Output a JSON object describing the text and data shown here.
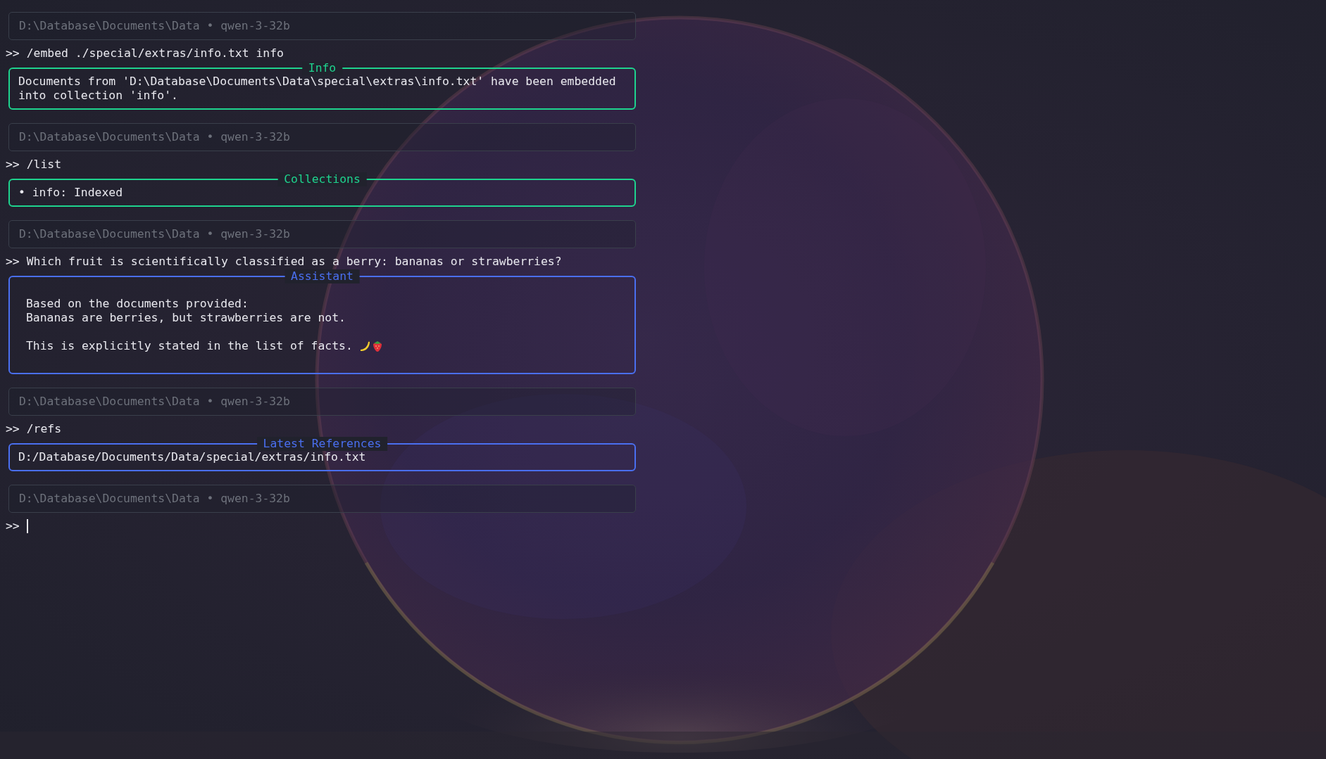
{
  "blocks": [
    {
      "kind": "status",
      "path": "D:\\Database\\Documents\\Data",
      "separator": "•",
      "model": "qwen-3-32b"
    },
    {
      "kind": "prompt",
      "marker": ">>",
      "text": "/embed ./special/extras/info.txt info"
    },
    {
      "kind": "panel",
      "title": "Info",
      "color": "#1ed38e",
      "padded": false,
      "lines": [
        {
          "text": "Documents from 'D:\\Database\\Documents\\Data\\special\\extras\\info.txt' have been embedded"
        },
        {
          "text": "into collection 'info'."
        }
      ]
    },
    {
      "kind": "status",
      "path": "D:\\Database\\Documents\\Data",
      "separator": "•",
      "model": "qwen-3-32b"
    },
    {
      "kind": "prompt",
      "marker": ">>",
      "text": "/list"
    },
    {
      "kind": "panel",
      "title": "Collections",
      "color": "#1ed38e",
      "padded": false,
      "lines": [
        {
          "text": "• info: Indexed"
        }
      ]
    },
    {
      "kind": "status",
      "path": "D:\\Database\\Documents\\Data",
      "separator": "•",
      "model": "qwen-3-32b"
    },
    {
      "kind": "prompt",
      "marker": ">>",
      "text": "Which fruit is scientifically classified as a berry: bananas or strawberries?"
    },
    {
      "kind": "panel",
      "title": "Assistant",
      "color": "#4a6ff0",
      "padded": true,
      "lines": [
        {
          "text": "Based on the documents provided:"
        },
        {
          "text": "Bananas are berries, but strawberries are not."
        },
        {
          "text": "This is explicitly stated in the list of facts.",
          "emoji": true,
          "gap_before": true
        }
      ]
    },
    {
      "kind": "status",
      "path": "D:\\Database\\Documents\\Data",
      "separator": "•",
      "model": "qwen-3-32b"
    },
    {
      "kind": "prompt",
      "marker": ">>",
      "text": "/refs"
    },
    {
      "kind": "panel",
      "title": "Latest References",
      "color": "#4a6ff0",
      "padded": false,
      "lines": [
        {
          "text": "D:/Database/Documents/Data/special/extras/info.txt"
        }
      ]
    },
    {
      "kind": "status",
      "path": "D:\\Database\\Documents\\Data",
      "separator": "•",
      "model": "qwen-3-32b"
    },
    {
      "kind": "prompt",
      "marker": ">>",
      "cursor": true
    }
  ]
}
